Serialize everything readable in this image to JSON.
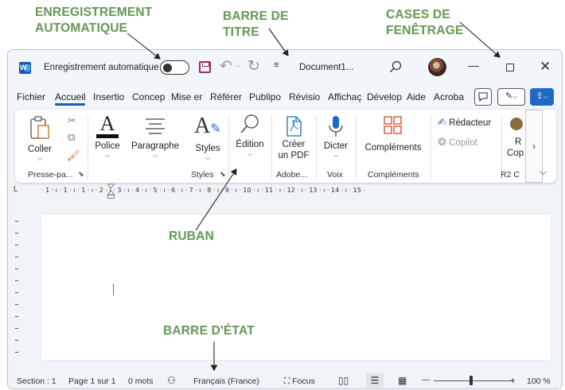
{
  "annotations": {
    "autosave": [
      "ENREGISTREMENT",
      "AUTOMATIQUE"
    ],
    "titlebar": [
      "BARRE DE",
      "TITRE"
    ],
    "window_controls": [
      "CASES DE",
      "FENÊTRAGE"
    ],
    "ribbon": "RUBAN",
    "statusbar": "BARRE D'ÉTAT",
    "color": "#6b9a5a"
  },
  "titlebar": {
    "app_icon": "word-icon",
    "autosave_label": "Enregistrement automatique",
    "autosave_on": false,
    "document_title": "Document1...",
    "quick_access": [
      "save-icon",
      "undo-icon",
      "redo-icon",
      "customize-qat-icon"
    ],
    "controls": [
      "minimize-icon",
      "maximize-icon",
      "close-icon"
    ]
  },
  "tabs": [
    {
      "label": "Fichier",
      "active": false
    },
    {
      "label": "Accueil",
      "active": true
    },
    {
      "label": "Insertio",
      "active": false
    },
    {
      "label": "Concep",
      "active": false
    },
    {
      "label": "Mise er",
      "active": false
    },
    {
      "label": "Référer",
      "active": false
    },
    {
      "label": "Publipo",
      "active": false
    },
    {
      "label": "Révisio",
      "active": false
    },
    {
      "label": "Affichaç",
      "active": false
    },
    {
      "label": "Dévelop",
      "active": false
    },
    {
      "label": "Aide",
      "active": false
    },
    {
      "label": "Acroba",
      "active": false
    }
  ],
  "ribbon": {
    "buttons": {
      "coller": "Coller",
      "police": "Police",
      "paragraphe": "Paragraphe",
      "styles": "Styles",
      "edition": "Édition",
      "creer_pdf_1": "Créer",
      "creer_pdf_2": "un PDF",
      "dicter": "Dicter",
      "complements": "Compléments",
      "redacteur": "Rédacteur",
      "copilot": "Copilot",
      "r2_top": "R",
      "r2_bottom": "Cop"
    },
    "groups": {
      "presse_papiers": "Presse-pa...",
      "styles": "Styles",
      "adobe": "Adobe...",
      "voix": "Voix",
      "complements": "Compléments",
      "r2": "R2 C"
    },
    "accent": "#185abd"
  },
  "ruler": {
    "text": "· 1 · ı · 1 · ı · 1 · ı · 2 · ı · 3 · ı · 4 · ı · 5 · ı · 6 · ı · 7 · ı · 8 · ı · 9 · ı · 10 · ı · 11 · ı · 12 · ı · 13 · ı · 14 · ı · 15 ·"
  },
  "statusbar": {
    "section": "Section : 1",
    "page": "Page 1 sur 1",
    "words": "0 mots",
    "language": "Français (France)",
    "focus": "Focus",
    "zoom_minus": "—",
    "zoom_plus": "+",
    "zoom": "100 %"
  }
}
